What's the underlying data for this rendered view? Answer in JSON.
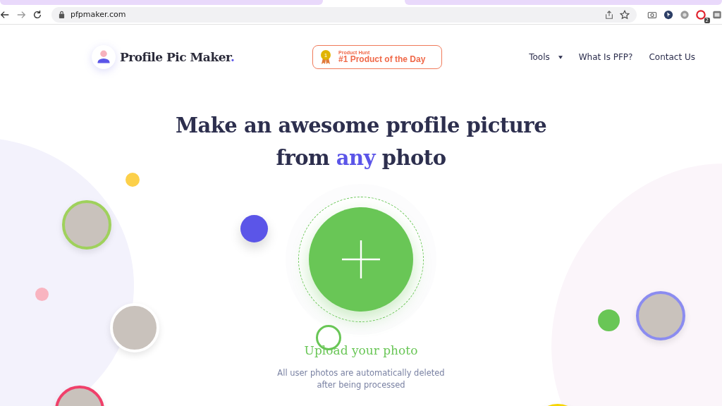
{
  "browser": {
    "url": "pfpmaker.com",
    "extension_badge": "2"
  },
  "header": {
    "brand": "Profile Pic Maker",
    "brand_dot": ".",
    "award": {
      "source": "Product Hunt",
      "title": "#1 Product of the Day",
      "medal_number": "1"
    },
    "nav": [
      {
        "label": "Tools",
        "dropdown": true
      },
      {
        "label": "What Is PFP?",
        "dropdown": false
      },
      {
        "label": "Contact Us",
        "dropdown": false
      }
    ]
  },
  "hero": {
    "line1": "Make an awesome profile picture",
    "line2_before": "from ",
    "highlight": "any",
    "line2_after": " photo",
    "upload_label": "Upload your photo",
    "note_line1": "All user photos are automatically deleted",
    "note_line2": "after being processed"
  }
}
